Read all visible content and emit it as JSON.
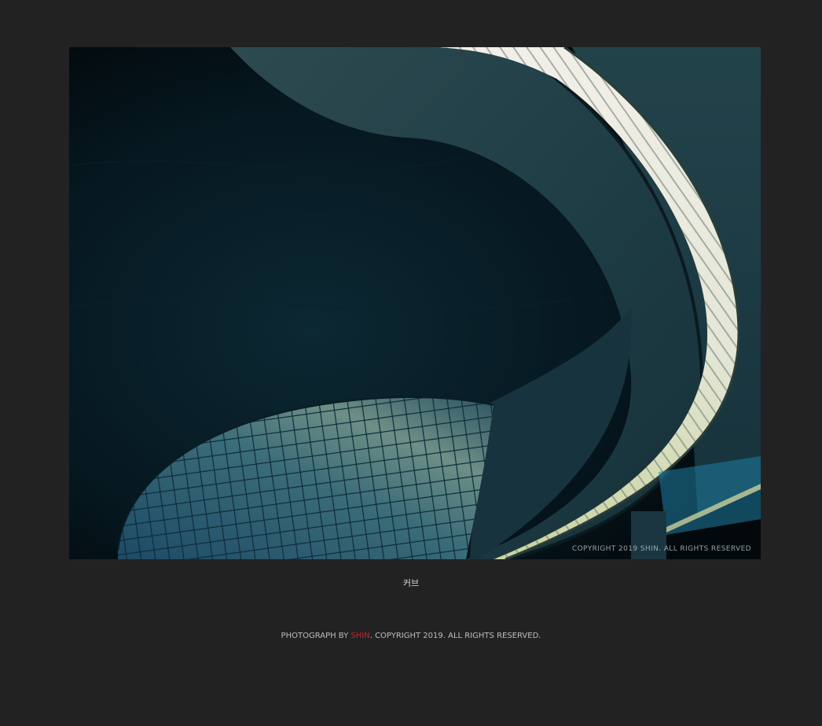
{
  "photo": {
    "watermark": "COPYRIGHT 2019 SHIN. ALL RIGHTS RESERVED"
  },
  "caption": "커브",
  "footer": {
    "prefix": "PHOTOGRAPH BY ",
    "author": "SHIN",
    "suffix": ". COPYRIGHT 2019. ALL RIGHTS RESERVED.",
    "author_color": "#c8242b"
  },
  "colors": {
    "background": "#222222",
    "text": "#bdbdbd"
  }
}
